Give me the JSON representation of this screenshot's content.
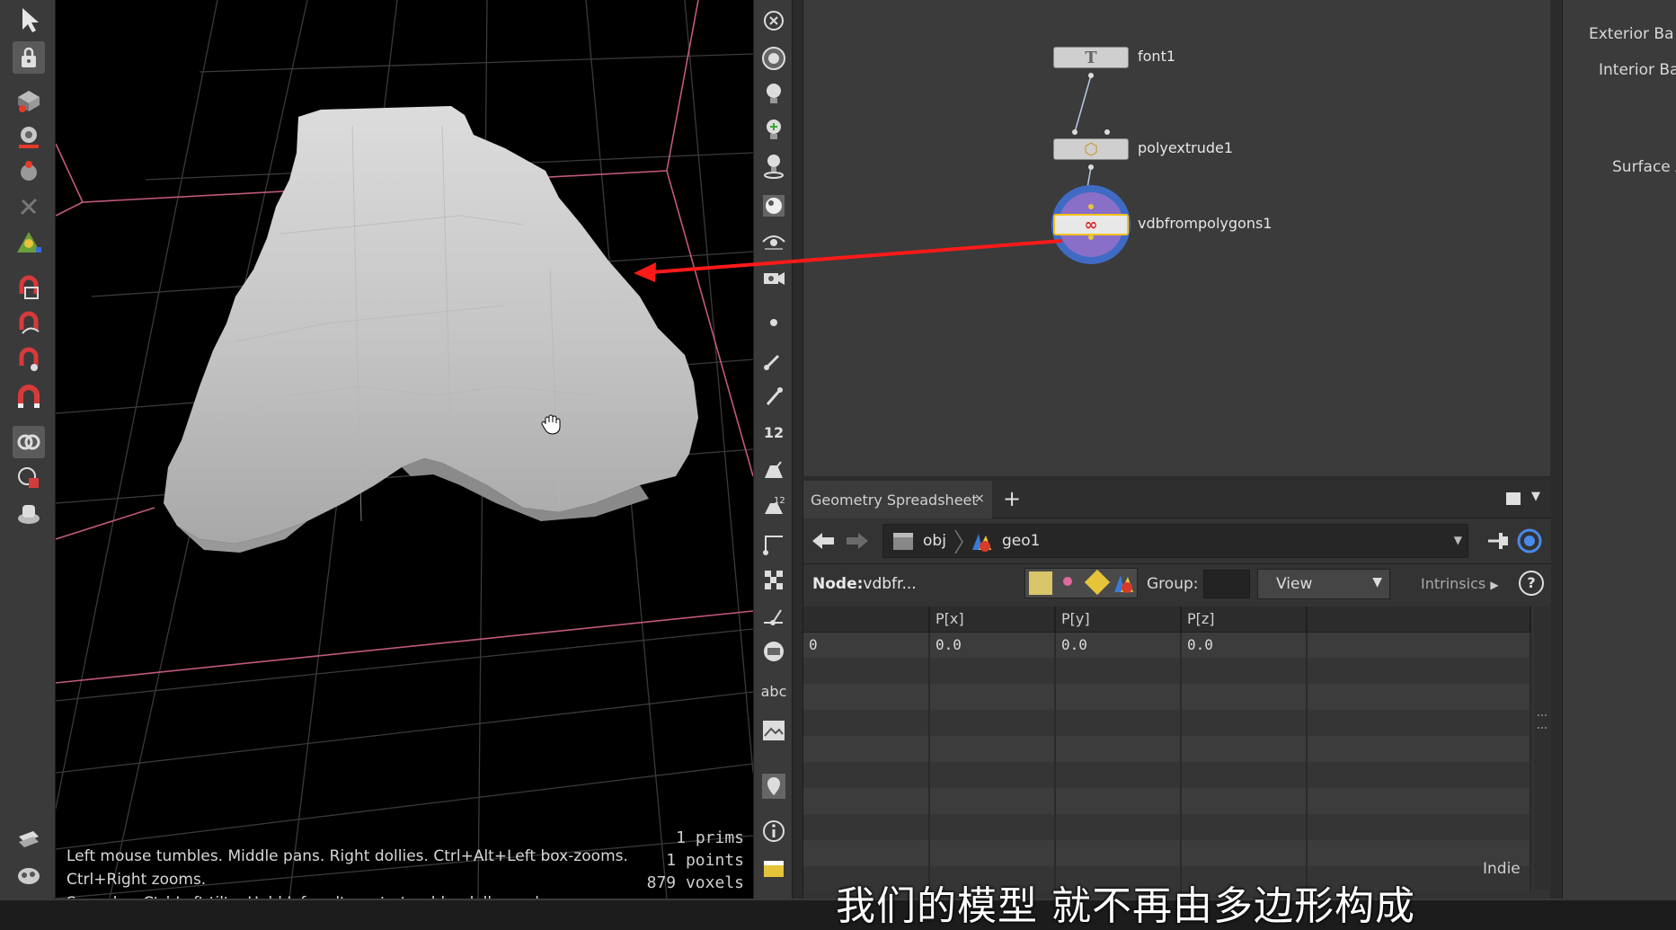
{
  "viewport": {
    "help_line1": "Left mouse tumbles. Middle pans. Right dollies. Ctrl+Alt+Left box-zooms. Ctrl+Right zooms.",
    "help_line2": "Spacebar-Ctrl-Left tilts. Hold L for alternate tumble, dolly, and zoom.",
    "stats": {
      "prims": "1  prims",
      "points": "1 points",
      "voxels": "879 voxels"
    }
  },
  "right_toolbar": {
    "text_tool": "abc",
    "number_tool": "12"
  },
  "network": {
    "nodes": [
      {
        "label": "font1",
        "glyph": "T"
      },
      {
        "label": "polyextrude1",
        "glyph": "⬡"
      },
      {
        "label": "vdbfrompolygons1",
        "glyph": "∞"
      }
    ],
    "annotation_color": "#ff1a1a"
  },
  "spreadsheet": {
    "tab_label": "Geometry Spreadsheet",
    "tab_close": "×",
    "add_tab": "+",
    "path": {
      "obj": "obj",
      "geo": "geo1"
    },
    "node_prefix": "Node:",
    "node_value": "vdbfr...",
    "group_label": "Group:",
    "view_label": "View",
    "intrinsics_label": "Intrinsics",
    "help_label": "?",
    "columns": [
      "",
      "P[x]",
      "P[y]",
      "P[z]",
      ""
    ],
    "rows": [
      [
        "0",
        "0.0",
        "0.0",
        "0.0",
        ""
      ],
      [
        "",
        "",
        "",
        "",
        ""
      ],
      [
        "",
        "",
        "",
        "",
        ""
      ],
      [
        "",
        "",
        "",
        "",
        ""
      ],
      [
        "",
        "",
        "",
        "",
        ""
      ],
      [
        "",
        "",
        "",
        "",
        ""
      ],
      [
        "",
        "",
        "",
        "",
        ""
      ],
      [
        "",
        "",
        "",
        "",
        ""
      ],
      [
        "",
        "",
        "",
        "",
        ""
      ],
      [
        "",
        "",
        "",
        "",
        ""
      ]
    ],
    "footer": "Indie"
  },
  "params": {
    "exterior": "Exterior Ba",
    "interior": "Interior Ba",
    "surface": "Surface A"
  },
  "subtitle": "我们的模型 就不再由多边形构成"
}
